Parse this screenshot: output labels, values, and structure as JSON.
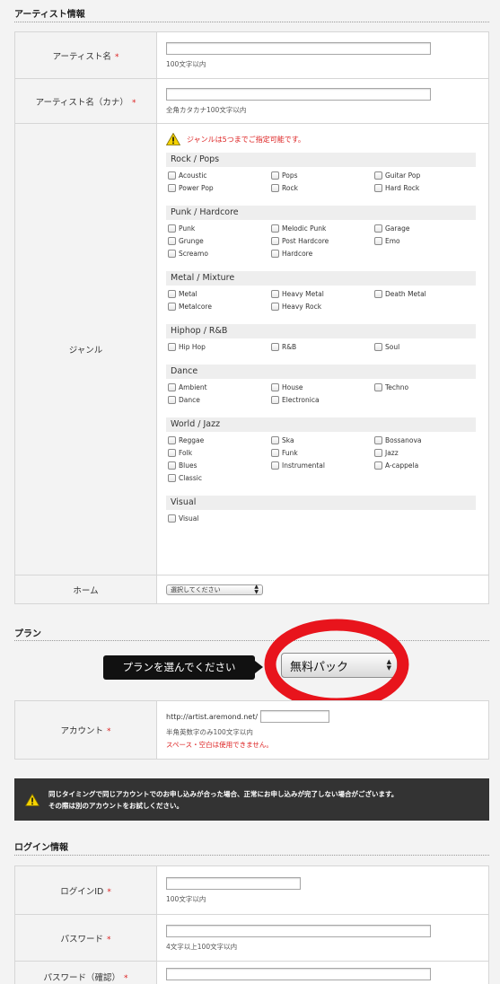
{
  "artist_section": {
    "title": "アーティスト情報",
    "name_label": "アーティスト名",
    "name_note": "100文字以内",
    "kana_label": "アーティスト名（カナ）",
    "kana_note": "全角カタカナ100文字以内",
    "required_mark": "*",
    "genre_label": "ジャンル",
    "genre_warning": "ジャンルは5つまでご指定可能です。",
    "genres": [
      {
        "name": "Rock / Pops",
        "items": [
          "Acoustic",
          "Pops",
          "Guitar Pop",
          "Power Pop",
          "Rock",
          "Hard Rock"
        ]
      },
      {
        "name": "Punk / Hardcore",
        "items": [
          "Punk",
          "Melodic Punk",
          "Garage",
          "Grunge",
          "Post Hardcore",
          "Emo",
          "Screamo",
          "Hardcore"
        ]
      },
      {
        "name": "Metal / Mixture",
        "items": [
          "Metal",
          "Heavy Metal",
          "Death Metal",
          "Metalcore",
          "Heavy Rock"
        ]
      },
      {
        "name": "Hiphop / R&B",
        "items": [
          "Hip Hop",
          "R&B",
          "Soul"
        ]
      },
      {
        "name": "Dance",
        "items": [
          "Ambient",
          "House",
          "Techno",
          "Dance",
          "Electronica"
        ]
      },
      {
        "name": "World / Jazz",
        "items": [
          "Reggae",
          "Ska",
          "Bossanova",
          "Folk",
          "Funk",
          "Jazz",
          "Blues",
          "Instrumental",
          "A-cappela",
          "Classic"
        ]
      },
      {
        "name": "Visual",
        "items": [
          "Visual"
        ]
      }
    ],
    "home_label": "ホーム",
    "home_select": "選択してください"
  },
  "plan_section": {
    "title": "プラン",
    "callout": "プランを選んでください",
    "selected_plan": "無料パック",
    "account_label": "アカウント",
    "account_prefix": "http://artist.aremond.net/",
    "account_note": "半角英数字のみ100文字以内",
    "account_warning": "スペース・空白は使用できません。"
  },
  "notice": {
    "line1": "同じタイミングで同じアカウントでのお申し込みが合った場合、正常にお申し込みが完了しない場合がございます。",
    "line2": "その際は別のアカウントをお試しください。"
  },
  "login_section": {
    "title": "ログイン情報",
    "login_id_label": "ログインID",
    "login_id_note": "100文字以内",
    "password_label": "パスワード",
    "password_note": "4文字以上100文字以内",
    "password_confirm_label": "パスワード（確認）"
  },
  "colors": {
    "required": "#dd2222",
    "highlight_ring": "#e8141c",
    "notice_bg": "#333333"
  }
}
